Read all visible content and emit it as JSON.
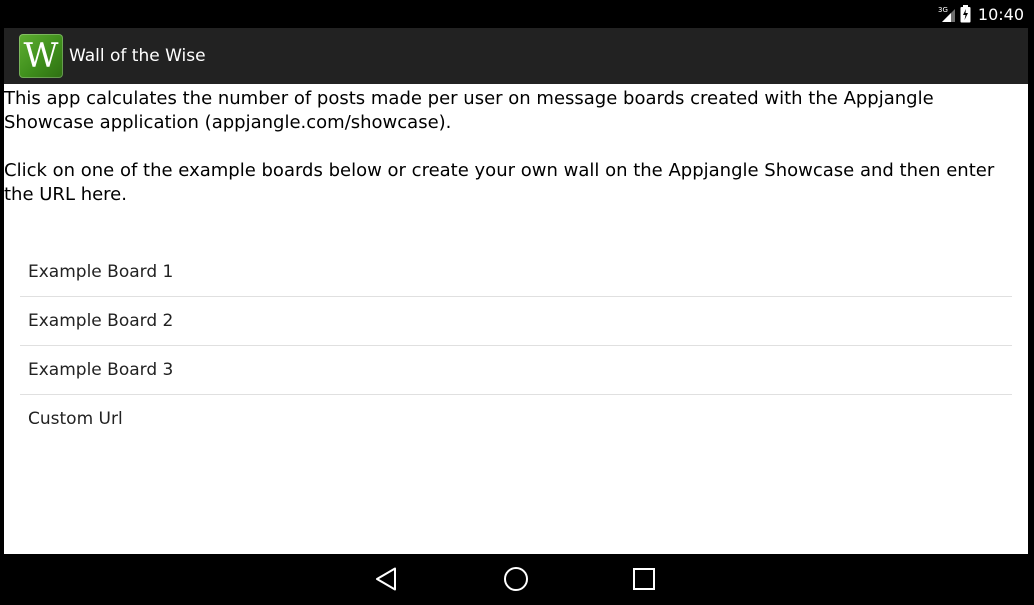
{
  "status_bar": {
    "network_label": "3G",
    "time": "10:40",
    "icons": [
      "signal-3g-icon",
      "battery-charging-icon"
    ]
  },
  "action_bar": {
    "logo_letter": "W",
    "title": "Wall of the Wise",
    "logo_color": "#3f8f1c"
  },
  "intro": {
    "paragraph1": "This app calculates the number of posts made per user on message boards created with the Appjangle Showcase application (appjangle.com/showcase).",
    "paragraph2": "Click on one of the example boards below or create your own wall on the Appjangle Showcase and then enter the URL here."
  },
  "boards": {
    "items": [
      {
        "label": "Example Board 1"
      },
      {
        "label": "Example Board 2"
      },
      {
        "label": "Example Board 3"
      },
      {
        "label": "Custom Url"
      }
    ]
  },
  "nav_bar": {
    "icons": [
      "back-icon",
      "home-icon",
      "recents-icon"
    ]
  }
}
